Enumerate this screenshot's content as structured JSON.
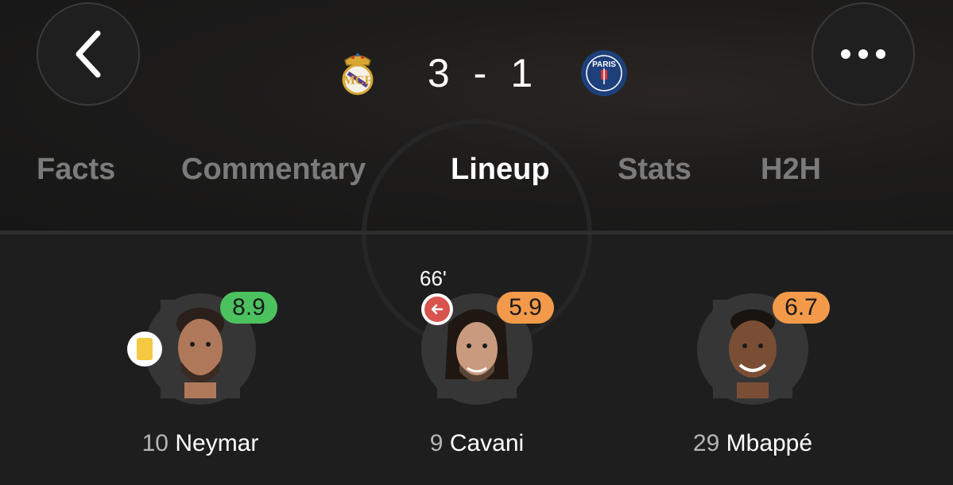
{
  "header": {
    "home_team": "Real Madrid",
    "away_team": "Paris Saint-Germain",
    "home_score": "3",
    "separator": "-",
    "away_score": "1"
  },
  "tabs": [
    {
      "label": "Facts",
      "active": false
    },
    {
      "label": "Commentary",
      "active": false
    },
    {
      "label": "Lineup",
      "active": true
    },
    {
      "label": "Stats",
      "active": false
    },
    {
      "label": "H2H",
      "active": false
    }
  ],
  "players": [
    {
      "number": "10",
      "name": "Neymar",
      "rating": "8.9",
      "rating_color": "#4cc25f",
      "yellow_card": true
    },
    {
      "number": "9",
      "name": "Cavani",
      "rating": "5.9",
      "rating_color": "#f39a4a",
      "sub_minute": "66'",
      "subbed_off": true
    },
    {
      "number": "29",
      "name": "Mbappé",
      "rating": "6.7",
      "rating_color": "#f39a4a"
    }
  ],
  "icons": {
    "back": "chevron-left-icon",
    "more": "more-horizontal-icon",
    "substitution": "arrow-left-icon",
    "card": "yellow-card-icon"
  }
}
